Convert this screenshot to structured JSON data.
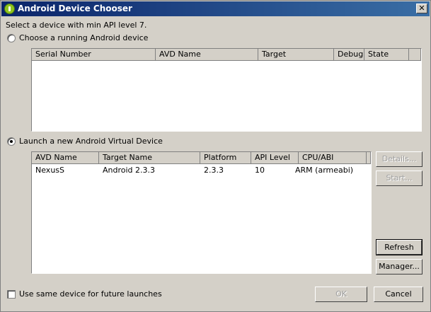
{
  "window": {
    "title": "Android Device Chooser",
    "close_glyph": "✕"
  },
  "prompt": "Select a device with min API level 7.",
  "running": {
    "radio_label": "Choose a running Android device",
    "columns": [
      "Serial Number",
      "AVD Name",
      "Target",
      "Debug",
      "State"
    ],
    "rows": []
  },
  "avd": {
    "radio_label": "Launch a new Android Virtual Device",
    "columns": [
      "AVD Name",
      "Target Name",
      "Platform",
      "API Level",
      "CPU/ABI"
    ],
    "rows": [
      {
        "avd_name": "NexusS",
        "target_name": "Android 2.3.3",
        "platform": "2.3.3",
        "api_level": "10",
        "cpu_abi": "ARM (armeabi)"
      }
    ],
    "buttons": {
      "details": "Details...",
      "start": "Start...",
      "refresh": "Refresh",
      "manager": "Manager..."
    }
  },
  "footer": {
    "checkbox_label": "Use same device for future launches",
    "ok": "OK",
    "cancel": "Cancel"
  },
  "state": {
    "selected_radio": "launch-new-avd",
    "use_same_device_checked": false
  }
}
